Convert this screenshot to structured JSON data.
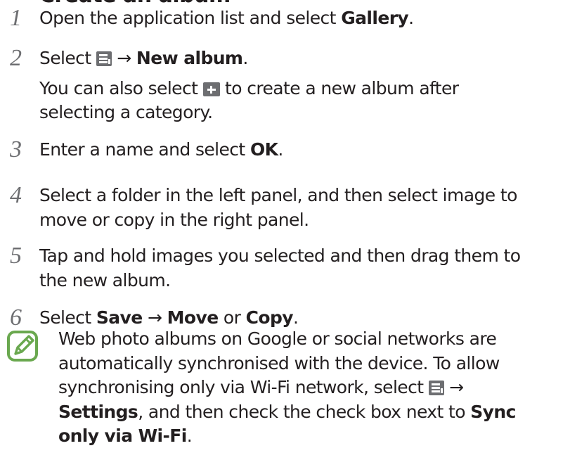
{
  "heading_fragment": "Create an album",
  "steps": [
    {
      "num": "1",
      "lines": [
        {
          "parts": [
            {
              "t": "Open the application list and select "
            },
            {
              "t": "Gallery",
              "b": true
            },
            {
              "t": "."
            }
          ]
        }
      ]
    },
    {
      "num": "2",
      "lines": [
        {
          "parts": [
            {
              "t": "Select "
            },
            {
              "icon": "menu-icon"
            },
            {
              "t": " → "
            },
            {
              "t": "New album",
              "b": true
            },
            {
              "t": "."
            }
          ]
        },
        {
          "parts": [
            {
              "t": "You can also select "
            },
            {
              "icon": "plus-icon"
            },
            {
              "t": " to create a new album after"
            }
          ]
        },
        {
          "parts": [
            {
              "t": "selecting a category."
            }
          ]
        }
      ]
    },
    {
      "num": "3",
      "lines": [
        {
          "parts": [
            {
              "t": "Enter a name and select "
            },
            {
              "t": "OK",
              "b": true
            },
            {
              "t": "."
            }
          ]
        }
      ]
    },
    {
      "num": "4",
      "lines": [
        {
          "parts": [
            {
              "t": "Select a folder in the left panel, and then select image to"
            }
          ]
        },
        {
          "parts": [
            {
              "t": "move or copy in the right panel."
            }
          ]
        }
      ]
    },
    {
      "num": "5",
      "lines": [
        {
          "parts": [
            {
              "t": "Tap and hold images you selected and then drag them to"
            }
          ]
        },
        {
          "parts": [
            {
              "t": "the new album."
            }
          ]
        }
      ]
    },
    {
      "num": "6",
      "lines": [
        {
          "parts": [
            {
              "t": "Select "
            },
            {
              "t": "Save",
              "b": true
            },
            {
              "t": " → "
            },
            {
              "t": "Move",
              "b": true
            },
            {
              "t": " or "
            },
            {
              "t": "Copy",
              "b": true
            },
            {
              "t": "."
            }
          ]
        }
      ]
    }
  ],
  "note": {
    "icon": "pencil-note-icon",
    "accent": "#6aa84f",
    "lines": [
      {
        "parts": [
          {
            "t": "Web photo albums on Google or social networks are"
          }
        ]
      },
      {
        "parts": [
          {
            "t": "automatically synchronised with the device. To allow"
          }
        ]
      },
      {
        "parts": [
          {
            "t": "synchronising only via Wi-Fi network, select "
          },
          {
            "icon": "menu-icon"
          },
          {
            "t": " →"
          }
        ]
      },
      {
        "parts": [
          {
            "t": "Settings",
            "b": true
          },
          {
            "t": ", and then check the check box next to "
          },
          {
            "t": "Sync",
            "b": true
          }
        ]
      },
      {
        "parts": [
          {
            "t": "only via Wi-Fi",
            "b": true
          },
          {
            "t": "."
          }
        ]
      }
    ]
  },
  "colors": {
    "text": "#231f20",
    "number_gray": "#6d6e71",
    "icon_gray": "#6d6e71",
    "note_green": "#6aa84f"
  }
}
